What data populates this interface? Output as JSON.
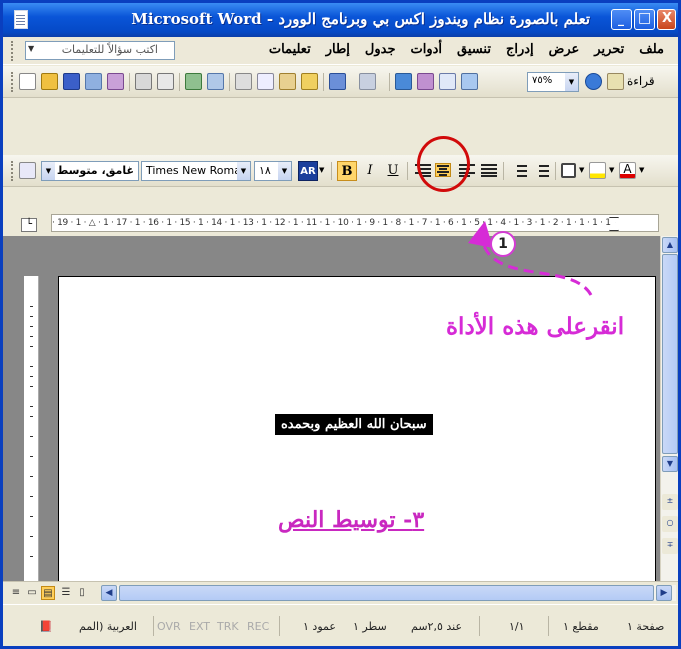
{
  "window": {
    "title": "Microsoft Word - تعلم بالصورة نظام ويندوز اكس بي وبرنامج الوورد",
    "close_glyph": "X",
    "maximize_glyph": "□",
    "minimize_glyph": "_"
  },
  "menubar": {
    "items": [
      "ملف",
      "تحرير",
      "عرض",
      "إدراج",
      "تنسيق",
      "أدوات",
      "جدول",
      "إطار",
      "تعليمات"
    ],
    "ask_placeholder": "اكتب سؤالاً للتعليمات"
  },
  "standard_toolbar": {
    "reading_label": "قراءة",
    "zoom": "٧٥%"
  },
  "formatting_toolbar": {
    "style": "غامق، متوسط ،",
    "font": "Times New Roman",
    "size": "١٨",
    "ar_label": "AR",
    "bold_label": "B",
    "italic_label": "I",
    "underline_label": "U",
    "active_button": "center-align"
  },
  "ruler": {
    "ticks": "· 19 · 1 · △ · 1 · 17 · 1 · 16 · 1 · 15 · 1 · 14 · 1 · 13 · 1 · 12 · 1 · 11 · 1 · 10 · 1 · 9 · 1 · 8 · 1 · 7 · 1 · 6 · 1 · 5 · 1 · 4 · 1 · 3 · 1 · 2 · 1 · 1 · 1 · 1 ·"
  },
  "document": {
    "highlighted_text": "سبحان الله العظيم وبحمده",
    "step_title": "٣- توسيط النص"
  },
  "annotation": {
    "text": "انقرعلى هذه الأداة",
    "badge_number": "1",
    "color": "#d62bd6",
    "circle_color": "#d10a0a"
  },
  "statusbar": {
    "page": "صفحة ١",
    "section": "مقطع ١",
    "pages": "١/١",
    "at": "عند ٢,٥سم",
    "line": "سطر ١",
    "column": "عمود ١",
    "rec": "REC",
    "trk": "TRK",
    "ext": "EXT",
    "ovr": "OVR",
    "language": "العربية (المم"
  },
  "colors": {
    "titlebar": "#0a55d8",
    "highlight_bg": "#000000",
    "step_text": "#c928c0"
  }
}
